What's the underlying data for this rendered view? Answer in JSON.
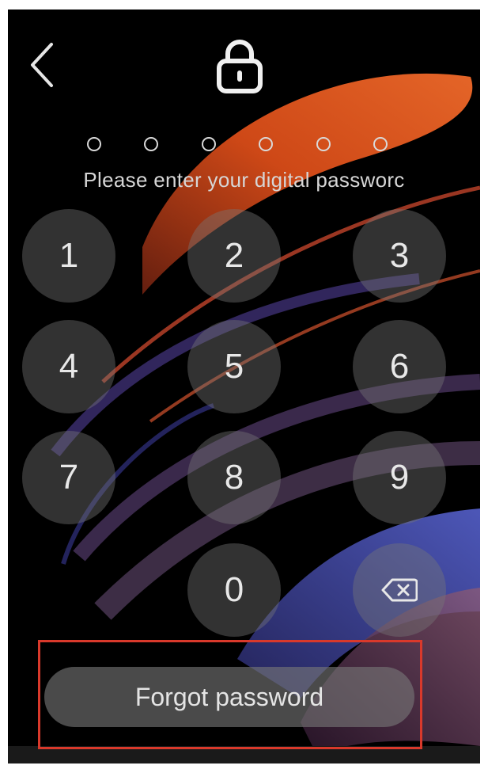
{
  "header": {
    "back_icon": "chevron-left-icon",
    "lock_icon": "lock-icon"
  },
  "pin": {
    "length": 6,
    "filled": 0,
    "prompt": "Please enter your digital passworc"
  },
  "keypad": {
    "keys": [
      "1",
      "2",
      "3",
      "4",
      "5",
      "6",
      "7",
      "8",
      "9",
      "0"
    ],
    "backspace_icon": "backspace-icon"
  },
  "forgot": {
    "label": "Forgot password",
    "highlight_color": "#d9392b"
  },
  "wallpaper": {
    "colors": [
      "#e0531c",
      "#a23a2a",
      "#4a56c8",
      "#7a4a70"
    ]
  }
}
